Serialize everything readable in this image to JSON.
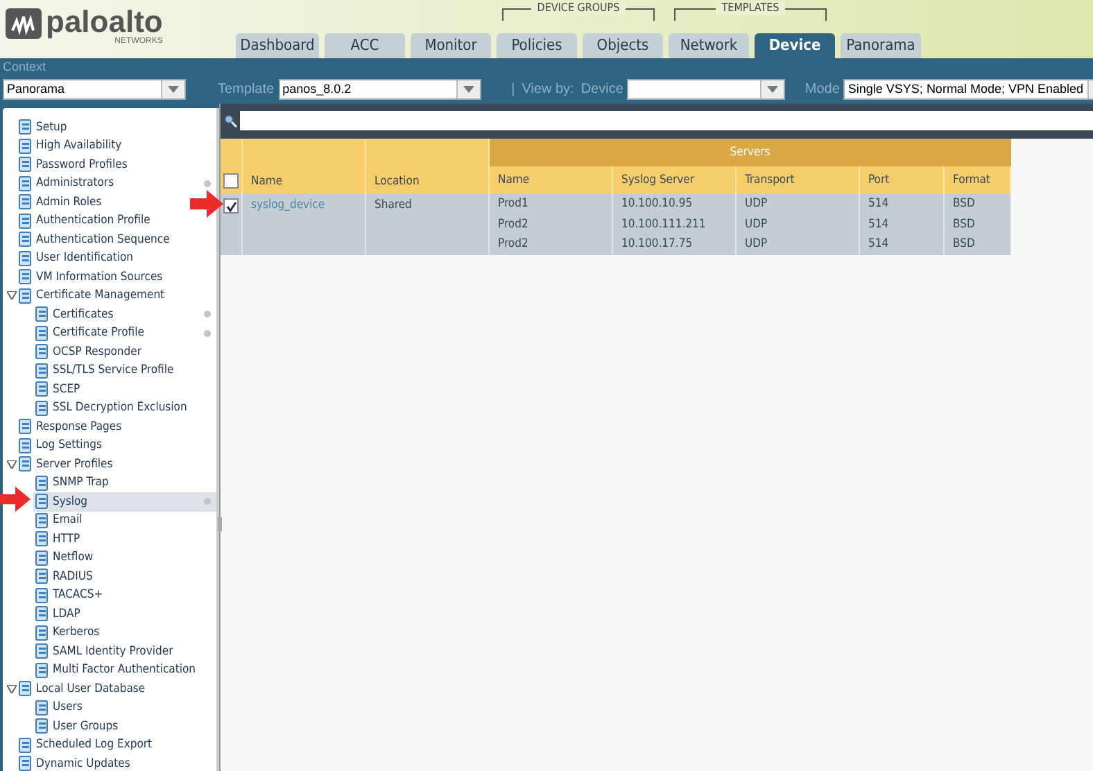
{
  "header": {
    "logo": "paloalto",
    "logo_sub": "NETWORKS",
    "groups": [
      {
        "label": "DEVICE GROUPS"
      },
      {
        "label": "TEMPLATES"
      }
    ],
    "tabs": [
      {
        "label": "Dashboard",
        "selected": false
      },
      {
        "label": "ACC",
        "selected": false
      },
      {
        "label": "Monitor",
        "selected": false
      },
      {
        "label": "Policies",
        "selected": false
      },
      {
        "label": "Objects",
        "selected": false
      },
      {
        "label": "Network",
        "selected": false
      },
      {
        "label": "Device",
        "selected": true
      },
      {
        "label": "Panorama",
        "selected": false
      }
    ]
  },
  "context_bar": {
    "context_label": "Context",
    "context_value": "Panorama",
    "template_label": "Template",
    "template_value": "panos_8.0.2",
    "separator": "|",
    "view_by_label": "View by:",
    "device_label": "Device",
    "mode_label": "Mode",
    "mode_value": "Single VSYS; Normal Mode; VPN Enabled"
  },
  "tree": [
    {
      "label": "Setup",
      "selected": false,
      "dot": false
    },
    {
      "label": "High Availability",
      "selected": false,
      "dot": false
    },
    {
      "label": "Password Profiles",
      "selected": false,
      "dot": false
    },
    {
      "label": "Administrators",
      "selected": false,
      "dot": true
    },
    {
      "label": "Admin Roles",
      "selected": false,
      "dot": false
    },
    {
      "label": "Authentication Profile",
      "selected": false,
      "dot": false
    },
    {
      "label": "Authentication Sequence",
      "selected": false,
      "dot": false
    },
    {
      "label": "User Identification",
      "selected": false,
      "dot": false
    },
    {
      "label": "VM Information Sources",
      "selected": false,
      "dot": false
    },
    {
      "label": "Certificate Management",
      "selected": false,
      "dot": false,
      "expanded": true,
      "children": [
        {
          "label": "Certificates",
          "selected": false,
          "dot": true
        },
        {
          "label": "Certificate Profile",
          "selected": false,
          "dot": true
        },
        {
          "label": "OCSP Responder",
          "selected": false,
          "dot": false
        },
        {
          "label": "SSL/TLS Service Profile",
          "selected": false,
          "dot": false
        },
        {
          "label": "SCEP",
          "selected": false,
          "dot": false
        },
        {
          "label": "SSL Decryption Exclusion",
          "selected": false,
          "dot": false
        }
      ]
    },
    {
      "label": "Response Pages",
      "selected": false,
      "dot": false
    },
    {
      "label": "Log Settings",
      "selected": false,
      "dot": false
    },
    {
      "label": "Server Profiles",
      "selected": false,
      "dot": false,
      "expanded": true,
      "children": [
        {
          "label": "SNMP Trap",
          "selected": false,
          "dot": false
        },
        {
          "label": "Syslog",
          "selected": true,
          "dot": true
        },
        {
          "label": "Email",
          "selected": false,
          "dot": false
        },
        {
          "label": "HTTP",
          "selected": false,
          "dot": false
        },
        {
          "label": "Netflow",
          "selected": false,
          "dot": false
        },
        {
          "label": "RADIUS",
          "selected": false,
          "dot": false
        },
        {
          "label": "TACACS+",
          "selected": false,
          "dot": false
        },
        {
          "label": "LDAP",
          "selected": false,
          "dot": false
        },
        {
          "label": "Kerberos",
          "selected": false,
          "dot": false
        },
        {
          "label": "SAML Identity Provider",
          "selected": false,
          "dot": false
        },
        {
          "label": "Multi Factor Authentication",
          "selected": false,
          "dot": false
        }
      ]
    },
    {
      "label": "Local User Database",
      "selected": false,
      "dot": false,
      "expanded": true,
      "children": [
        {
          "label": "Users",
          "selected": false,
          "dot": false
        },
        {
          "label": "User Groups",
          "selected": false,
          "dot": false
        }
      ]
    },
    {
      "label": "Scheduled Log Export",
      "selected": false,
      "dot": false
    },
    {
      "label": "Dynamic Updates",
      "selected": false,
      "dot": false
    }
  ],
  "table": {
    "group_header": "Servers",
    "columns": [
      "Name",
      "Location"
    ],
    "server_columns": [
      "Name",
      "Syslog Server",
      "Transport",
      "Port",
      "Format"
    ],
    "header_checked": false,
    "rows": [
      {
        "name": "syslog_device",
        "location": "Shared",
        "checked": true,
        "servers": [
          [
            "Prod1",
            "10.100.10.95",
            "UDP",
            "514",
            "BSD"
          ],
          [
            "Prod2",
            "10.100.111.211",
            "UDP",
            "514",
            "BSD"
          ],
          [
            "Prod2",
            "10.100.17.75",
            "UDP",
            "514",
            "BSD"
          ]
        ]
      }
    ]
  }
}
